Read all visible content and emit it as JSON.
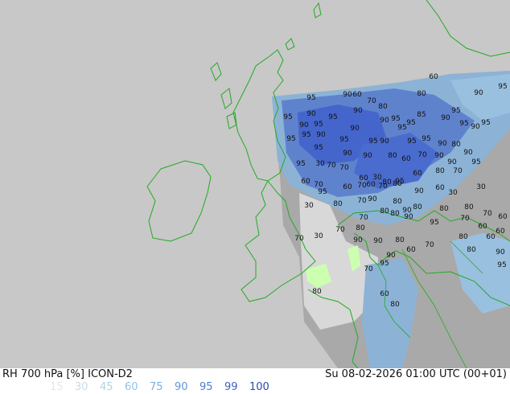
{
  "header": {
    "title_left": "RH 700 hPa [%] ICON-D2",
    "title_right": "Su 08-02-2026 01:00 UTC (00+01)"
  },
  "legend": {
    "items": [
      {
        "label": "15",
        "color": "#dce8f0"
      },
      {
        "label": "30",
        "color": "#c8dcea"
      },
      {
        "label": "45",
        "color": "#b4d0e4"
      },
      {
        "label": "60",
        "color": "#8cc4ec"
      },
      {
        "label": "75",
        "color": "#78b0e0"
      },
      {
        "label": "90",
        "color": "#6496d4"
      },
      {
        "label": "95",
        "color": "#4f7ccc"
      },
      {
        "label": "99",
        "color": "#3c62c0"
      },
      {
        "label": "100",
        "color": "#2848b4"
      }
    ]
  },
  "map": {
    "colors": {
      "background": "#c8c8c8",
      "coastline": "#22aa22",
      "land": "#b4b48c",
      "dry_low": "#e0e0e0",
      "dry_mid": "#a0a0a0",
      "moist": "#8ab0d0",
      "very_moist": "#5a7ac8",
      "saturated": "#3c5ccc",
      "bright_green_patch": "#ccffb0"
    },
    "contour_labels": [
      "95",
      "90",
      "60",
      "70",
      "80",
      "80",
      "60",
      "90",
      "95",
      "95",
      "90",
      "95",
      "90",
      "95",
      "90",
      "90",
      "95",
      "95",
      "85",
      "90",
      "95",
      "95",
      "90",
      "95",
      "95",
      "95",
      "90",
      "95",
      "90",
      "95",
      "90",
      "95",
      "95",
      "95",
      "90",
      "80",
      "90",
      "95",
      "90",
      "90",
      "80",
      "60",
      "70",
      "90",
      "90",
      "95",
      "95",
      "30",
      "70",
      "70",
      "60",
      "30",
      "80",
      "95",
      "60",
      "80",
      "70",
      "60",
      "70",
      "95",
      "60",
      "70",
      "60",
      "70",
      "80",
      "90",
      "60",
      "30",
      "30",
      "30",
      "80",
      "70",
      "90",
      "80",
      "90",
      "80",
      "80",
      "80",
      "70",
      "60",
      "70",
      "80",
      "80",
      "90",
      "95",
      "70",
      "60",
      "60",
      "70",
      "30",
      "70",
      "80",
      "90",
      "90",
      "80",
      "60",
      "70",
      "80",
      "90",
      "80",
      "60",
      "70",
      "95",
      "90",
      "95",
      "80",
      "60",
      "80"
    ]
  }
}
